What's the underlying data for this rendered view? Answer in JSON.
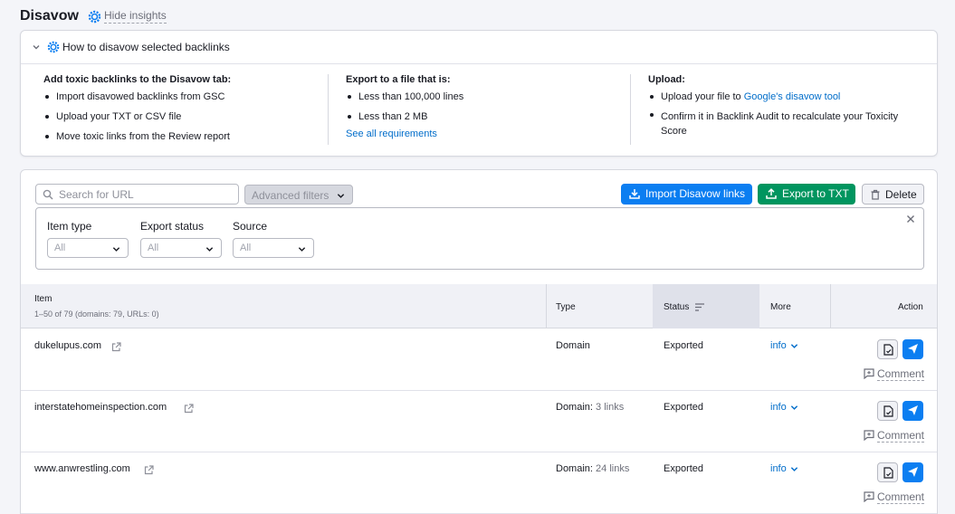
{
  "page": {
    "title": "Disavow",
    "hide_insights": "Hide insights"
  },
  "insights": {
    "title": "How to disavow selected backlinks",
    "columns": [
      {
        "heading": "Add toxic backlinks to the Disavow tab:",
        "items": [
          "Import disavowed backlinks from GSC",
          "Upload your TXT or CSV file",
          "Move toxic links from the Review report"
        ]
      },
      {
        "heading": "Export to a file that is:",
        "items": [
          "Less than 100,000 lines",
          "Less than 2 MB"
        ],
        "link": "See all requirements"
      },
      {
        "heading": "Upload:",
        "item1_prefix": "Upload your file to ",
        "item1_link": "Google's disavow tool",
        "item2": "Confirm it in Backlink Audit to recalculate your Toxicity Score"
      }
    ]
  },
  "toolbar": {
    "search_placeholder": "Search for URL",
    "advanced_filters": "Advanced filters",
    "import_label": "Import Disavow links",
    "export_label": "Export to TXT",
    "delete_label": "Delete"
  },
  "filters": [
    {
      "label": "Item type",
      "value": "All"
    },
    {
      "label": "Export status",
      "value": "All"
    },
    {
      "label": "Source",
      "value": "All"
    }
  ],
  "table": {
    "headers": {
      "item": "Item",
      "item_sub": "1–50 of 79 (domains: 79, URLs: 0)",
      "type": "Type",
      "status": "Status",
      "more": "More",
      "action": "Action"
    },
    "rows": [
      {
        "domain": "dukelupus.com",
        "type": "Domain",
        "count": "",
        "status": "Exported",
        "more": "info",
        "comment": "Comment"
      },
      {
        "domain": "interstatehomeinspection.com",
        "type": "Domain:",
        "count": "3 links",
        "status": "Exported",
        "more": "info",
        "comment": "Comment"
      },
      {
        "domain": "www.anwrestling.com",
        "type": "Domain:",
        "count": "24 links",
        "status": "Exported",
        "more": "info",
        "comment": "Comment"
      }
    ]
  },
  "colors": {
    "primary_blue": "#0b7ef1",
    "green": "#00955f",
    "link": "#006dca"
  }
}
